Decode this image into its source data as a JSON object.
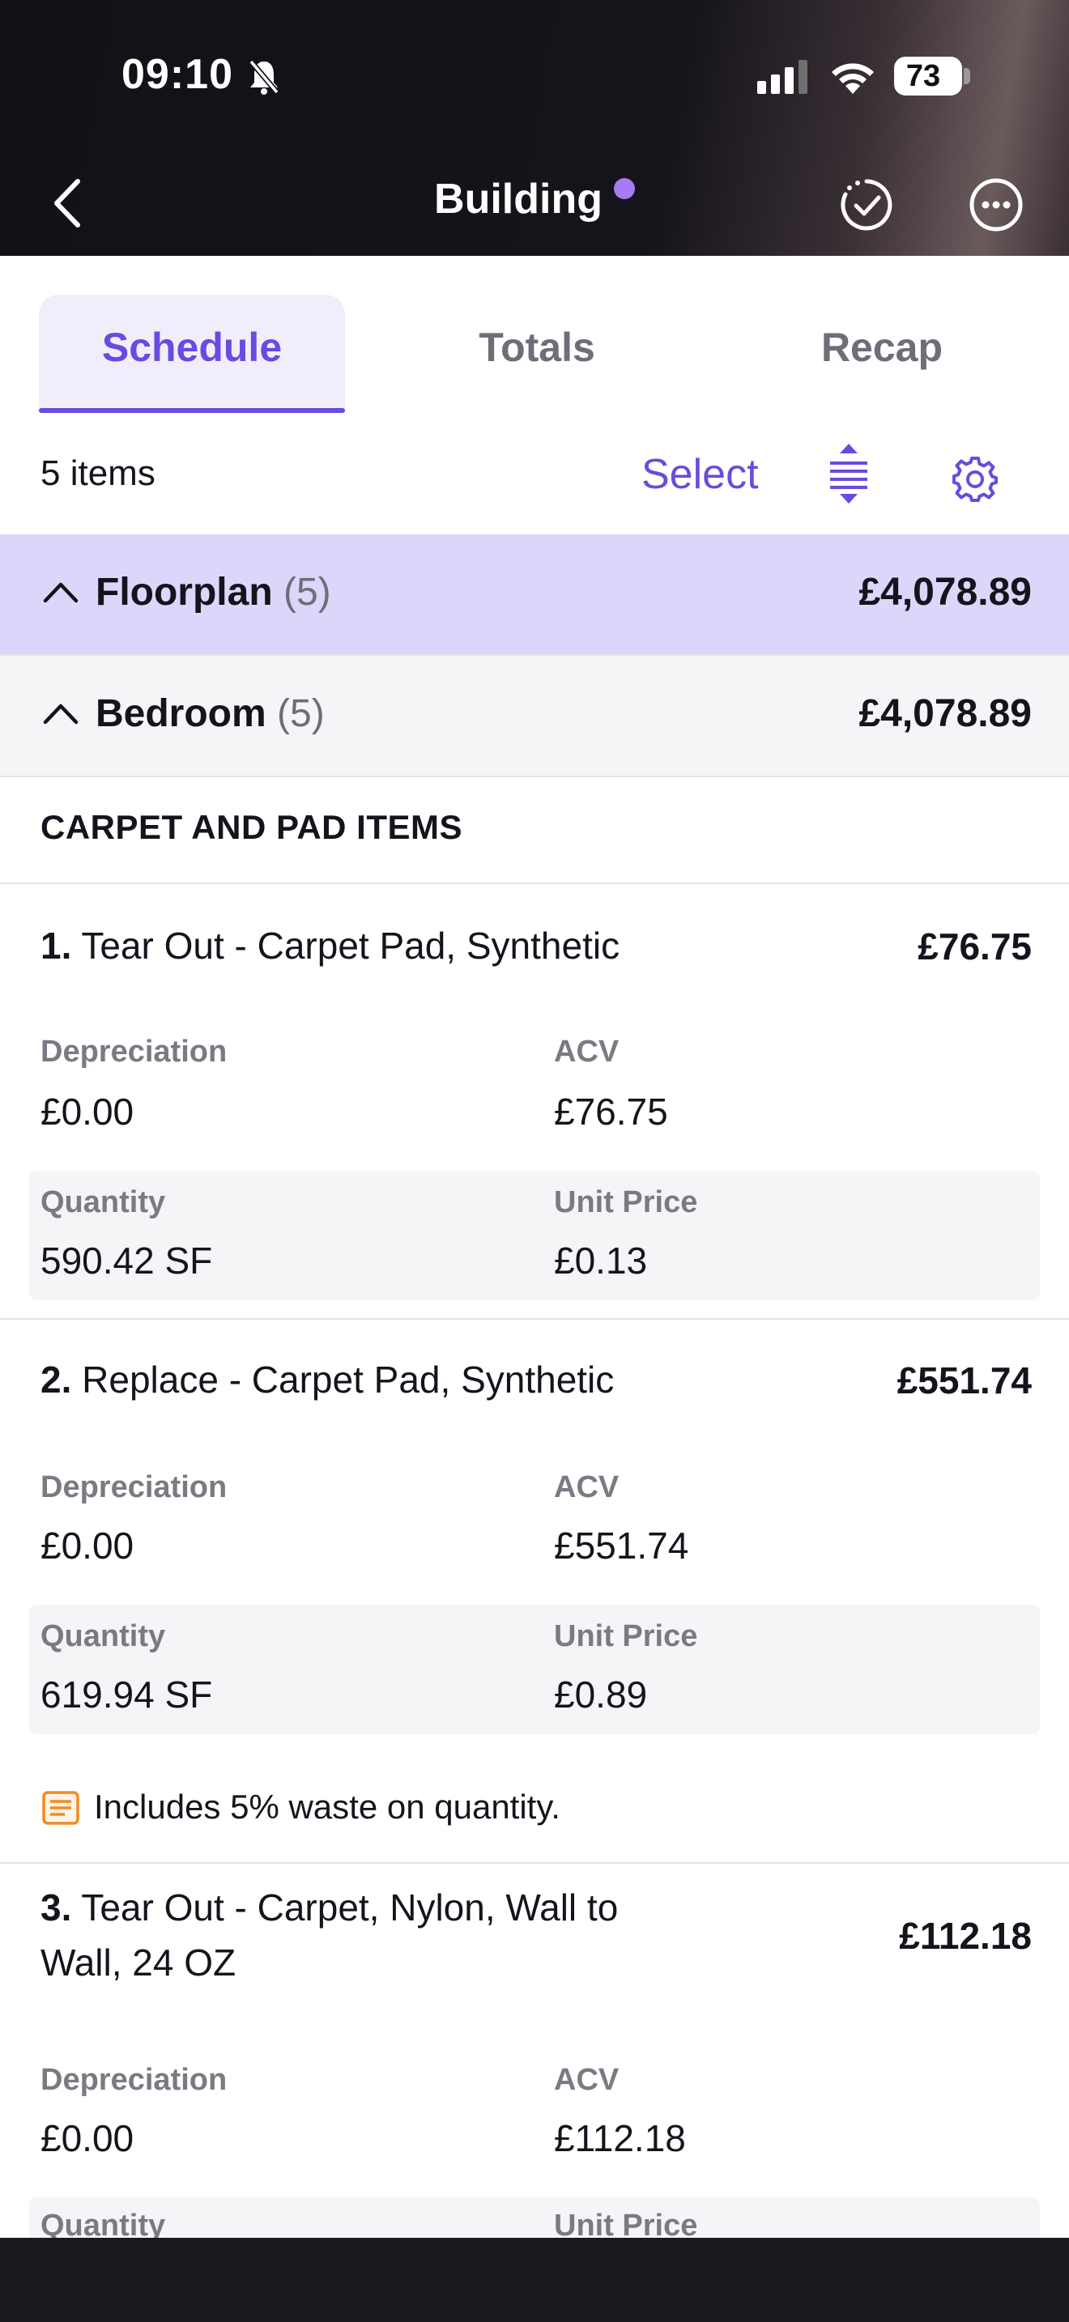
{
  "status_bar": {
    "time": "09:10",
    "battery": "73"
  },
  "nav": {
    "title": "Building",
    "icons": [
      "back-icon",
      "sync-check-icon",
      "more-icon"
    ]
  },
  "tabs": [
    {
      "label": "Schedule",
      "active": true
    },
    {
      "label": "Totals",
      "active": false
    },
    {
      "label": "Recap",
      "active": false
    }
  ],
  "toolbar": {
    "count": "5 items",
    "select_label": "Select"
  },
  "groups": {
    "floorplan": {
      "name": "Floorplan",
      "count": "(5)",
      "total": "£4,078.89"
    },
    "bedroom": {
      "name": "Bedroom",
      "count": "(5)",
      "total": "£4,078.89"
    }
  },
  "section": {
    "title": "CARPET AND PAD ITEMS"
  },
  "labels": {
    "depreciation": "Depreciation",
    "acv": "ACV",
    "quantity": "Quantity",
    "unit_price": "Unit Price"
  },
  "items": [
    {
      "num": "1.",
      "desc": "Tear Out - Carpet Pad, Synthetic",
      "total": "£76.75",
      "depreciation": "£0.00",
      "acv": "£76.75",
      "quantity": "590.42 SF",
      "unit_price": "£0.13"
    },
    {
      "num": "2.",
      "desc": "Replace - Carpet Pad, Synthetic",
      "total": "£551.74",
      "depreciation": "£0.00",
      "acv": "£551.74",
      "quantity": "619.94 SF",
      "unit_price": "£0.89",
      "note": "Includes 5% waste on quantity."
    },
    {
      "num": "3.",
      "desc": "Tear Out - Carpet, Nylon, Wall to Wall, 24 OZ",
      "total": "£112.18",
      "depreciation": "£0.00",
      "acv": "£112.18"
    }
  ],
  "colors": {
    "accent": "#6a4ae0",
    "group_bg": "#dcd6fb",
    "dot": "#a77bf3",
    "note_icon": "#f08a24"
  }
}
